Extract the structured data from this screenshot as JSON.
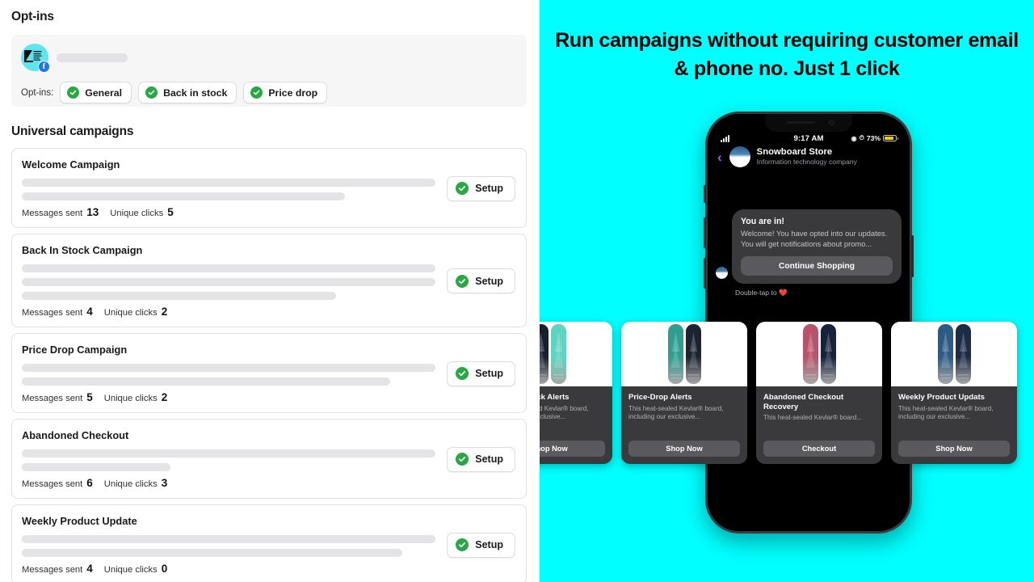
{
  "left": {
    "optins_section_title": "Opt-ins",
    "optins_label": "Opt-ins:",
    "optins_chips": [
      {
        "label": "General",
        "icon": "check-circle-icon"
      },
      {
        "label": "Back in stock",
        "icon": "check-circle-icon"
      },
      {
        "label": "Price drop",
        "icon": "check-circle-icon"
      }
    ],
    "avatar": {
      "icon": "facebook-badge-icon",
      "badge_letter": "f"
    },
    "campaigns_section_title": "Universal campaigns",
    "stat_labels": {
      "sent": "Messages sent",
      "clicks": "Unique clicks"
    },
    "setup_label": "Setup",
    "campaigns": [
      {
        "name": "Welcome Campaign",
        "messages_sent": "13",
        "unique_clicks": "5",
        "skeleton_widths": [
          "100%",
          "78%"
        ]
      },
      {
        "name": "Back In Stock Campaign",
        "messages_sent": "4",
        "unique_clicks": "2",
        "skeleton_widths": [
          "100%",
          "100%",
          "76%"
        ]
      },
      {
        "name": "Price Drop Campaign",
        "messages_sent": "5",
        "unique_clicks": "2",
        "skeleton_widths": [
          "100%",
          "89%"
        ]
      },
      {
        "name": "Abandoned Checkout",
        "messages_sent": "6",
        "unique_clicks": "3",
        "skeleton_widths": [
          "100%",
          "36%"
        ]
      },
      {
        "name": "Weekly Product Update",
        "messages_sent": "4",
        "unique_clicks": "0",
        "skeleton_widths": [
          "100%",
          "92%"
        ]
      }
    ]
  },
  "right": {
    "headline": "Run campaigns without requiring customer email & phone no. Just 1 click",
    "background_color": "#00FFFF",
    "phone": {
      "status_bar": {
        "time": "9:17 AM",
        "battery_percent": "73%",
        "signal_icon": "cellular-signal-icon",
        "alarm_icon": "alarm-icon",
        "lock_icon": "orientation-lock-icon"
      },
      "chat_header": {
        "back_icon": "back-chevron-icon",
        "store_name": "Snowboard Store",
        "store_subtitle": "Information technology company"
      },
      "message": {
        "title": "You are in!",
        "body": "Welcome! You have opted into our updates. You will get notifications about promo...",
        "cta_label": "Continue Shopping",
        "footer": "Double-tap to ❤️"
      }
    },
    "product_cards": [
      {
        "title": "Back-In-Stock Alerts",
        "desc": "This heat-sealed Kevlar® board, including our exclusive...",
        "cta": "Shop Now",
        "board_colors": [
          "#16202e",
          "#5fd4c0"
        ]
      },
      {
        "title": "Price-Drop Alerts",
        "desc": "This heat-sealed Kevlar® board, including our exclusive...",
        "cta": "Shop Now",
        "board_colors": [
          "#2f9e8f",
          "#1d2430"
        ]
      },
      {
        "title": "Abandoned Checkout Recovery",
        "desc": "This heat-sealed Kevlar® board...",
        "cta": "Checkout",
        "board_colors": [
          "#b8536b",
          "#17233c"
        ]
      },
      {
        "title": "Weekly Product Updats",
        "desc": "This heat-sealed Kevlar® board, including our exclusive...",
        "cta": "Shop Now",
        "board_colors": [
          "#2a5c86",
          "#1c2b46"
        ]
      }
    ]
  }
}
